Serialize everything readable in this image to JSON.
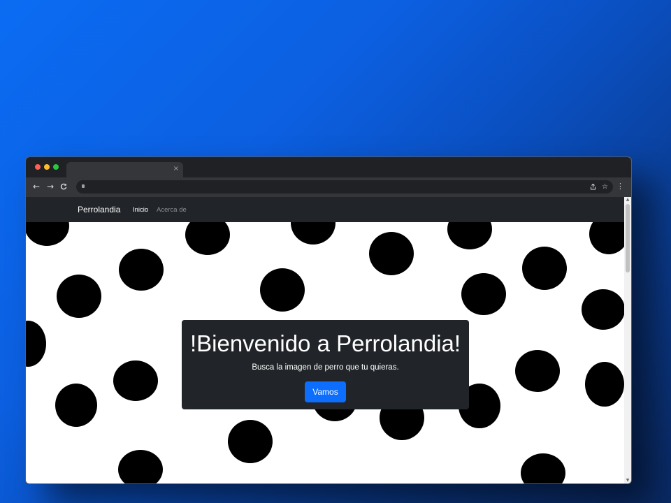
{
  "browser": {
    "window_controls": [
      "close",
      "minimize",
      "maximize"
    ],
    "window_control_colors": [
      "#ff5f57",
      "#febc2e",
      "#28c840"
    ],
    "tab": {
      "title": "",
      "close_glyph": "×"
    },
    "toolbar": {
      "back_icon": "arrow-left-icon",
      "forward_icon": "arrow-right-icon",
      "reload_icon": "reload-icon",
      "address_url": "",
      "share_icon": "share-icon",
      "bookmark_icon": "star-icon",
      "menu_icon": "more-vertical-icon"
    }
  },
  "site": {
    "navbar": {
      "brand": "Perrolandia",
      "links": [
        {
          "label": "Inicio",
          "active": true
        },
        {
          "label": "Acerca de",
          "active": false
        }
      ]
    },
    "hero": {
      "title": "!Bienvenido a Perrolandia!",
      "subtitle": "Busca la imagen de perro que tu quieras.",
      "button_label": "Vamos"
    },
    "background_pattern": "black-dots"
  },
  "colors": {
    "page_gradient_start": "#0b6cf3",
    "page_gradient_end": "#0a2a66",
    "navbar_bg": "#212529",
    "hero_bg": "#212529",
    "button_bg": "#0d6efd",
    "dot_color": "#000000"
  }
}
